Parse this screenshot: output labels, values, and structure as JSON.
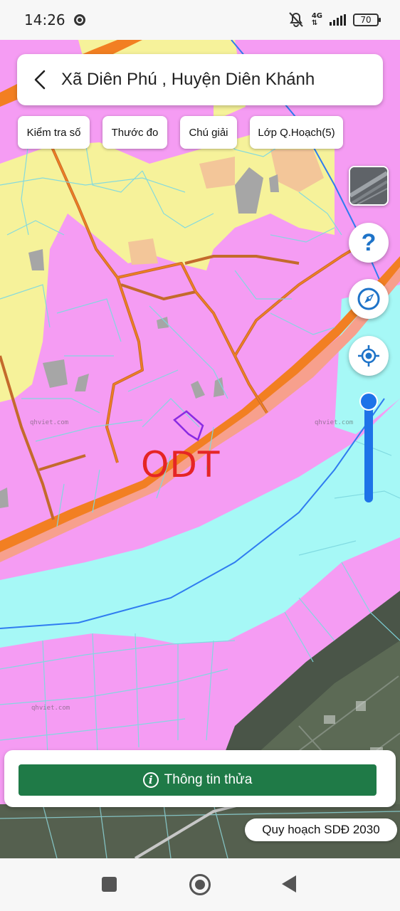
{
  "status_bar": {
    "time": "14:26",
    "network_label": "4G",
    "battery": "70"
  },
  "header": {
    "title": "Xã Diên Phú , Huyện Diên Khánh"
  },
  "toolbar": {
    "chips": [
      {
        "label": "Kiểm tra số"
      },
      {
        "label": "Thước đo"
      },
      {
        "label": "Chú giải"
      },
      {
        "label": "Lớp Q.Hoạch(5)"
      }
    ]
  },
  "map": {
    "zone_label": "ODT",
    "watermark": "qhviet.com",
    "colors": {
      "residential": "#f59cf3",
      "agriculture": "#f6f29a",
      "water": "#a6f8f6",
      "road": "#f27f22",
      "road_buffer": "#f7a08d",
      "parcel_line": "#7fd9e0",
      "selected_parcel": "#8a2be2",
      "accent_blue": "#1e73e8"
    }
  },
  "controls": {
    "help_symbol": "?",
    "zoom_level": 0.95
  },
  "bottom": {
    "info_button_label": "Thông tin thửa",
    "info_icon_symbol": "i",
    "plan_badge": "Quy hoạch SDĐ 2030",
    "button_color": "#1f7a47"
  }
}
